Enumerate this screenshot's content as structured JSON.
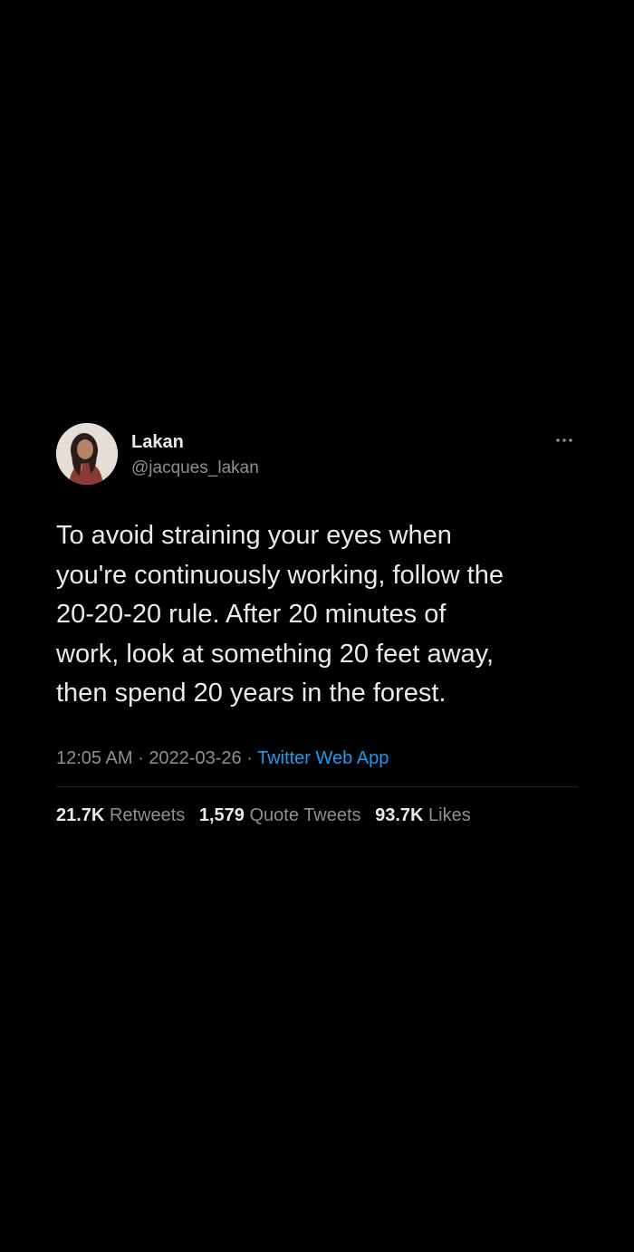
{
  "author": {
    "name": "Lakan",
    "handle": "@jacques_lakan"
  },
  "tweet": {
    "text": "To avoid straining your eyes when\nyou're continuously working, follow the\n20-20-20 rule. After 20 minutes of\nwork, look at something 20 feet away,\nthen spend 20 years in the forest.",
    "time": "12:05 AM",
    "separator": "·",
    "date": "2022-03-26",
    "source": "Twitter Web App"
  },
  "stats": {
    "retweets_count": "21.7K",
    "retweets_label": "Retweets",
    "quotes_count": "1,579",
    "quotes_label": "Quote Tweets",
    "likes_count": "93.7K",
    "likes_label": "Likes"
  },
  "icons": {
    "more": "more-horizontal-icon"
  },
  "colors": {
    "background": "#000000",
    "primary_text": "#e7e9ea",
    "secondary_text": "#8b9096",
    "link": "#1d9bf0"
  }
}
